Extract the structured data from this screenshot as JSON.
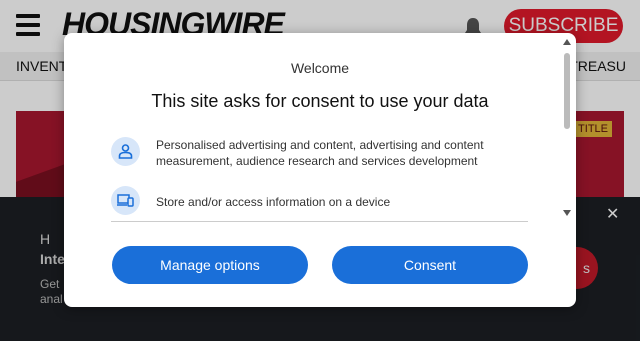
{
  "site": {
    "logo": "HOUSINGWIRE",
    "subscribe_label": "SUBSCRIBE",
    "nav_left": "INVENTO",
    "nav_right": "TREASU",
    "hero_tag": "TITLE"
  },
  "promo": {
    "image_alt": "H",
    "title": "Inte",
    "text_line1": "Get",
    "text_line2": "anal",
    "button_label": "s"
  },
  "dialog": {
    "welcome": "Welcome",
    "heading": "This site asks for consent to use your data",
    "purposes": [
      {
        "icon": "person-icon",
        "text": "Personalised advertising and content, advertising and content measurement, audience research and services development"
      },
      {
        "icon": "devices-icon",
        "text": "Store and/or access information on a device"
      }
    ],
    "manage_label": "Manage options",
    "consent_label": "Consent"
  },
  "colors": {
    "accent_blue": "#1a6fd9",
    "subscribe_red": "#e01a2b",
    "icon_bg": "#d7e6f9",
    "promo_bg": "#1c1f24"
  }
}
